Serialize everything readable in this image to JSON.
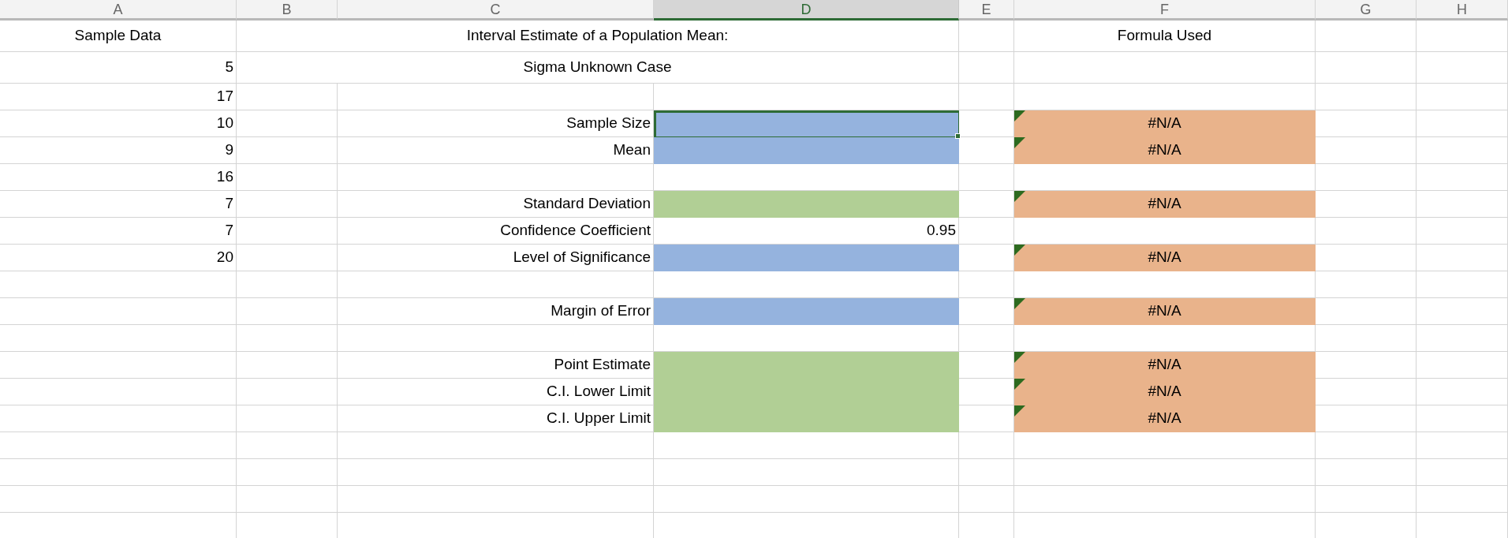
{
  "columns": [
    {
      "label": "A",
      "selected": false
    },
    {
      "label": "B",
      "selected": false
    },
    {
      "label": "C",
      "selected": false
    },
    {
      "label": "D",
      "selected": true
    },
    {
      "label": "E",
      "selected": false
    },
    {
      "label": "F",
      "selected": false
    },
    {
      "label": "G",
      "selected": false
    },
    {
      "label": "H",
      "selected": false
    }
  ],
  "rows": [
    [
      {
        "kind": "heading",
        "text": "Sample Data",
        "selected": false
      },
      null,
      {
        "kind": "title",
        "text": "Interval Estimate of a Population Mean:",
        "selected": false
      },
      null,
      null,
      {
        "kind": "heading",
        "text": "Formula Used",
        "selected": false
      },
      null,
      null
    ],
    [
      {
        "kind": "value",
        "text": "5",
        "selected": false
      },
      null,
      {
        "kind": "title",
        "text": "Sigma Unknown Case",
        "selected": false
      },
      null,
      null,
      null,
      null,
      null
    ],
    [
      {
        "kind": "value",
        "text": "17",
        "selected": false
      },
      null,
      null,
      null,
      null,
      null,
      null,
      null
    ],
    [
      {
        "kind": "value",
        "text": "10",
        "selected": false
      },
      null,
      {
        "kind": "value",
        "text": "Sample Size",
        "selected": false
      },
      {
        "kind": "value",
        "color": "#95b3de",
        "selected": true
      },
      null,
      {
        "kind": "heading",
        "text": "#N/A",
        "color": "#e9b38b",
        "flagged": true,
        "selected": false
      },
      null,
      null
    ],
    [
      {
        "kind": "value",
        "text": "9",
        "selected": false
      },
      null,
      {
        "kind": "value",
        "text": "Mean",
        "selected": false
      },
      {
        "kind": "value",
        "color": "#95b3de",
        "selected": false
      },
      null,
      {
        "kind": "heading",
        "text": "#N/A",
        "color": "#e9b38b",
        "flagged": true,
        "selected": false
      },
      null,
      null
    ],
    [
      {
        "kind": "value",
        "text": "16",
        "selected": false
      },
      null,
      null,
      null,
      null,
      null,
      null,
      null
    ],
    [
      {
        "kind": "value",
        "text": "7",
        "selected": false
      },
      null,
      {
        "kind": "value",
        "text": "Standard Deviation",
        "selected": false
      },
      {
        "kind": "value",
        "color": "#b1cf95",
        "selected": false
      },
      null,
      {
        "kind": "heading",
        "text": "#N/A",
        "color": "#e9b38b",
        "flagged": true,
        "selected": false
      },
      null,
      null
    ],
    [
      {
        "kind": "value",
        "text": "7",
        "selected": false
      },
      null,
      {
        "kind": "value",
        "text": "Confidence Coefficient",
        "selected": false
      },
      {
        "kind": "value",
        "text": "0.95",
        "selected": false
      },
      null,
      null,
      null,
      null
    ],
    [
      {
        "kind": "value",
        "text": "20",
        "selected": false
      },
      null,
      {
        "kind": "value",
        "text": "Level of Significance",
        "selected": false
      },
      {
        "kind": "value",
        "color": "#95b3de",
        "selected": false
      },
      null,
      {
        "kind": "heading",
        "text": "#N/A",
        "color": "#e9b38b",
        "flagged": true,
        "selected": false
      },
      null,
      null
    ],
    [
      null,
      null,
      null,
      null,
      null,
      null,
      null,
      null
    ],
    [
      null,
      null,
      {
        "kind": "value",
        "text": "Margin of Error",
        "selected": false
      },
      {
        "kind": "value",
        "color": "#95b3de",
        "selected": false
      },
      null,
      {
        "kind": "heading",
        "text": "#N/A",
        "color": "#e9b38b",
        "flagged": true,
        "selected": false
      },
      null,
      null
    ],
    [
      null,
      null,
      null,
      null,
      null,
      null,
      null,
      null
    ],
    [
      null,
      null,
      {
        "kind": "value",
        "text": "Point Estimate",
        "selected": false
      },
      {
        "kind": "value",
        "color": "#b1cf95",
        "selected": false
      },
      null,
      {
        "kind": "heading",
        "text": "#N/A",
        "color": "#e9b38b",
        "flagged": true,
        "selected": false
      },
      null,
      null
    ],
    [
      null,
      null,
      {
        "kind": "value",
        "text": "C.I. Lower Limit",
        "selected": false
      },
      {
        "kind": "value",
        "color": "#b1cf95",
        "selected": false
      },
      null,
      {
        "kind": "heading",
        "text": "#N/A",
        "color": "#e9b38b",
        "flagged": true,
        "selected": false
      },
      null,
      null
    ],
    [
      null,
      null,
      {
        "kind": "value",
        "text": "C.I. Upper Limit",
        "selected": false
      },
      {
        "kind": "value",
        "color": "#b1cf95",
        "selected": false
      },
      null,
      {
        "kind": "heading",
        "text": "#N/A",
        "color": "#e9b38b",
        "flagged": true,
        "selected": false
      },
      null,
      null
    ],
    [
      null,
      null,
      null,
      null,
      null,
      null,
      null,
      null
    ],
    [
      null,
      null,
      null,
      null,
      null,
      null,
      null,
      null
    ],
    [
      null,
      null,
      null,
      null,
      null,
      null,
      null,
      null
    ],
    [
      null,
      null,
      null,
      null,
      null,
      null,
      null,
      null
    ]
  ]
}
